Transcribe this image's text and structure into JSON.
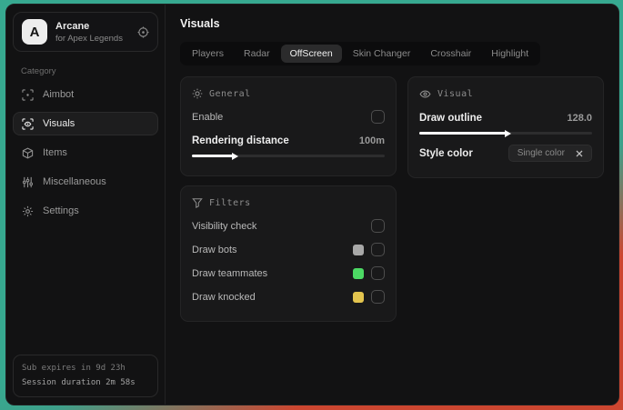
{
  "sidebar": {
    "brand": {
      "logo_letter": "A",
      "title": "Arcane",
      "subtitle": "for Apex Legends"
    },
    "category_label": "Category",
    "items": [
      {
        "label": "Aimbot"
      },
      {
        "label": "Visuals"
      },
      {
        "label": "Items"
      },
      {
        "label": "Miscellaneous"
      },
      {
        "label": "Settings"
      }
    ],
    "footer": {
      "sub_expires": "Sub expires in 9d 23h",
      "session_duration": "Session duration 2m 58s"
    }
  },
  "header": {
    "title": "Visuals"
  },
  "tabs": [
    {
      "label": "Players"
    },
    {
      "label": "Radar"
    },
    {
      "label": "OffScreen"
    },
    {
      "label": "Skin Changer"
    },
    {
      "label": "Crosshair"
    },
    {
      "label": "Highlight"
    }
  ],
  "panels": {
    "general": {
      "title": "General",
      "enable_label": "Enable",
      "rendering_distance_label": "Rendering distance",
      "rendering_distance_value": "100m",
      "rendering_distance_fill": "21%"
    },
    "visual": {
      "title": "Visual",
      "draw_outline_label": "Draw outline",
      "draw_outline_value": "128.0",
      "draw_outline_fill": "50%",
      "style_color_label": "Style color",
      "style_color_value": "Single color"
    },
    "filters": {
      "title": "Filters",
      "rows": [
        {
          "label": "Visibility check",
          "swatch": ""
        },
        {
          "label": "Draw bots",
          "swatch": "#a8a8a8"
        },
        {
          "label": "Draw teammates",
          "swatch": "#4cd964"
        },
        {
          "label": "Draw knocked",
          "swatch": "#e3c44e"
        }
      ]
    }
  },
  "colors": {
    "background_teal": "#37a990",
    "background_red": "#cc4630",
    "swatch_gray": "#a8a8a8",
    "swatch_green": "#4cd964",
    "swatch_yellow": "#e3c44e"
  }
}
